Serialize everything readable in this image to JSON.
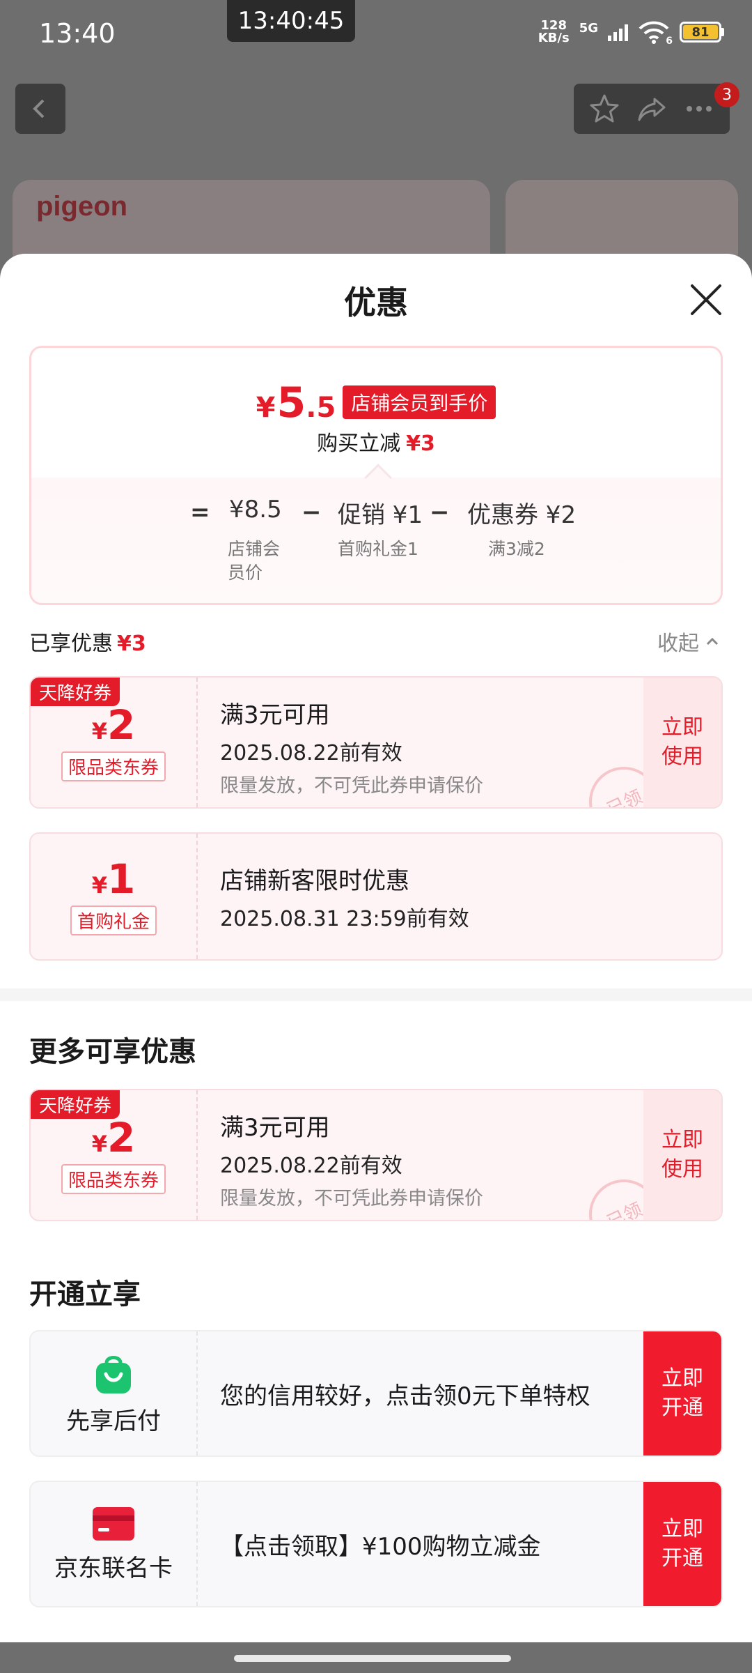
{
  "status_bar": {
    "time": "13:40",
    "clock_overlay": "13:40:45",
    "net_speed_value": "128",
    "net_speed_unit": "KB/s",
    "network": "5G",
    "wifi_label": "6",
    "battery": "81"
  },
  "background": {
    "brand_logo": "pigeon",
    "notification_count": "3"
  },
  "sheet": {
    "title": "优惠",
    "summary": {
      "final_price_symbol": "¥",
      "final_price_int": "5",
      "final_price_dec": ".5",
      "member_tag": "店铺会员到手价",
      "reduce_label": "购买立减",
      "reduce_amount": "¥3",
      "eq": "=",
      "base_price": "¥8.5",
      "minus": "−",
      "promo": "促销 ¥1",
      "coupon": "优惠券 ¥2",
      "base_price_label": "店铺会员价",
      "promo_label": "首购礼金1",
      "coupon_label": "满3减2"
    },
    "enjoyed": {
      "label": "已享优惠",
      "amount": "¥3",
      "collapse_label": "收起"
    },
    "enjoyed_coupons": [
      {
        "ribbon": "天降好券",
        "symbol": "¥",
        "amount": "2",
        "type": "限品类东券",
        "condition": "满3元可用",
        "expiry": "2025.08.22前有效",
        "note": "限量发放，不可凭此券申请保价",
        "action": "立即使用",
        "stamp": "已领"
      },
      {
        "symbol": "¥",
        "amount": "1",
        "type": "首购礼金",
        "condition": "店铺新客限时优惠",
        "expiry": "2025.08.31 23:59前有效"
      }
    ],
    "more_title": "更多可享优惠",
    "more_coupons": [
      {
        "ribbon": "天降好券",
        "symbol": "¥",
        "amount": "2",
        "type": "限品类东券",
        "condition": "满3元可用",
        "expiry": "2025.08.22前有效",
        "note": "限量发放，不可凭此券申请保价",
        "action": "立即使用",
        "stamp": "已领"
      }
    ],
    "open_title": "开通立享",
    "services": [
      {
        "icon": "shopping-bag-icon",
        "name": "先享后付",
        "desc": "您的信用较好，点击领0元下单特权",
        "action": "立即开通"
      },
      {
        "icon": "credit-card-icon",
        "name": "京东联名卡",
        "desc": "【点击领取】¥100购物立减金",
        "action": "立即开通"
      }
    ]
  },
  "colors": {
    "accent": "#e41c2a",
    "button_red": "#f01b2d",
    "bag_green": "#1dc46f",
    "card_red": "#e8203a"
  }
}
